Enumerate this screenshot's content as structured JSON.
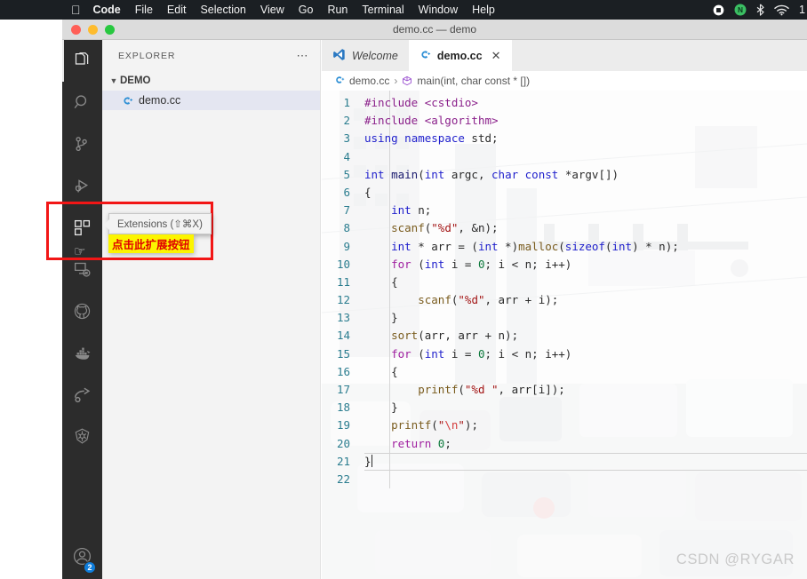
{
  "menubar": {
    "apple_icon": "apple-icon",
    "items": [
      {
        "label": "Code",
        "bold": true
      },
      {
        "label": "File",
        "bold": false
      },
      {
        "label": "Edit",
        "bold": false
      },
      {
        "label": "Selection",
        "bold": false
      },
      {
        "label": "View",
        "bold": false
      },
      {
        "label": "Go",
        "bold": false
      },
      {
        "label": "Run",
        "bold": false
      },
      {
        "label": "Terminal",
        "bold": false
      },
      {
        "label": "Window",
        "bold": false
      },
      {
        "label": "Help",
        "bold": false
      }
    ],
    "status_icons": [
      "record-stop-icon",
      "nordvpn-icon",
      "bluetooth-icon",
      "wifi-icon"
    ],
    "clock": "1"
  },
  "window": {
    "title": "demo.cc — demo",
    "traffic_lights": [
      "close-red",
      "minimize-yellow",
      "zoom-green"
    ]
  },
  "activitybar": {
    "items": [
      {
        "name": "explorer",
        "icon": "files-icon",
        "active": true
      },
      {
        "name": "search",
        "icon": "search-icon",
        "active": false
      },
      {
        "name": "source-control",
        "icon": "source-control-icon",
        "active": false
      },
      {
        "name": "run-and-debug",
        "icon": "run-debug-icon",
        "active": false
      },
      {
        "name": "extensions",
        "icon": "extensions-icon",
        "active": false
      },
      {
        "name": "remote-explorer",
        "icon": "remote-explorer-icon",
        "active": false
      },
      {
        "name": "github",
        "icon": "github-icon",
        "active": false
      },
      {
        "name": "docker",
        "icon": "docker-icon",
        "active": false
      },
      {
        "name": "share",
        "icon": "share-arrow-icon",
        "active": false
      },
      {
        "name": "kubernetes",
        "icon": "kubernetes-icon",
        "active": false
      }
    ],
    "account": {
      "icon": "account-icon",
      "badge": "2"
    }
  },
  "sidebar": {
    "header": "EXPLORER",
    "more_actions": "⋯",
    "folder": {
      "label": "DEMO",
      "expanded": true
    },
    "files": [
      {
        "label": "demo.cc",
        "icon": "cpp-file-icon",
        "selected": true
      }
    ]
  },
  "editor": {
    "tabs": [
      {
        "label": "Welcome",
        "icon": "vscode-logo-icon",
        "active": false,
        "closable": false
      },
      {
        "label": "demo.cc",
        "icon": "cpp-file-icon",
        "active": true,
        "closable": true,
        "close_label": "✕"
      }
    ],
    "breadcrumb": {
      "file": "demo.cc",
      "separator": "›",
      "symbol": "main(int, char const * [])",
      "symbol_icon": "method-icon"
    },
    "cursor_line": 21,
    "lines": [
      {
        "n": 1,
        "tokens": [
          {
            "t": "#include ",
            "c": "pre"
          },
          {
            "t": "<cstdio>",
            "c": "pre"
          }
        ]
      },
      {
        "n": 2,
        "tokens": [
          {
            "t": "#include ",
            "c": "pre"
          },
          {
            "t": "<algorithm>",
            "c": "pre"
          }
        ]
      },
      {
        "n": 3,
        "tokens": [
          {
            "t": "using",
            "c": "kw"
          },
          {
            "t": " ",
            "c": "plain"
          },
          {
            "t": "namespace",
            "c": "kw"
          },
          {
            "t": " std;",
            "c": "plain"
          }
        ]
      },
      {
        "n": 4,
        "tokens": []
      },
      {
        "n": 5,
        "tokens": [
          {
            "t": "int",
            "c": "kw"
          },
          {
            "t": " ",
            "c": "plain"
          },
          {
            "t": "main",
            "c": "var"
          },
          {
            "t": "(",
            "c": "plain"
          },
          {
            "t": "int",
            "c": "kw"
          },
          {
            "t": " argc, ",
            "c": "plain"
          },
          {
            "t": "char",
            "c": "kw"
          },
          {
            "t": " ",
            "c": "plain"
          },
          {
            "t": "const",
            "c": "kw"
          },
          {
            "t": " *argv[])",
            "c": "plain"
          }
        ]
      },
      {
        "n": 6,
        "tokens": [
          {
            "t": "{",
            "c": "plain"
          }
        ]
      },
      {
        "n": 7,
        "tokens": [
          {
            "t": "    ",
            "c": "plain"
          },
          {
            "t": "int",
            "c": "kw"
          },
          {
            "t": " n;",
            "c": "plain"
          }
        ]
      },
      {
        "n": 8,
        "tokens": [
          {
            "t": "    ",
            "c": "plain"
          },
          {
            "t": "scanf",
            "c": "fn"
          },
          {
            "t": "(",
            "c": "plain"
          },
          {
            "t": "\"%d\"",
            "c": "str"
          },
          {
            "t": ", &n);",
            "c": "plain"
          }
        ]
      },
      {
        "n": 9,
        "tokens": [
          {
            "t": "    ",
            "c": "plain"
          },
          {
            "t": "int",
            "c": "kw"
          },
          {
            "t": " * arr = (",
            "c": "plain"
          },
          {
            "t": "int",
            "c": "kw"
          },
          {
            "t": " *)",
            "c": "plain"
          },
          {
            "t": "malloc",
            "c": "fn"
          },
          {
            "t": "(",
            "c": "plain"
          },
          {
            "t": "sizeof",
            "c": "kw"
          },
          {
            "t": "(",
            "c": "plain"
          },
          {
            "t": "int",
            "c": "kw"
          },
          {
            "t": ") * n);",
            "c": "plain"
          }
        ]
      },
      {
        "n": 10,
        "tokens": [
          {
            "t": "    ",
            "c": "plain"
          },
          {
            "t": "for",
            "c": "kw2"
          },
          {
            "t": " (",
            "c": "plain"
          },
          {
            "t": "int",
            "c": "kw"
          },
          {
            "t": " i = ",
            "c": "plain"
          },
          {
            "t": "0",
            "c": "num"
          },
          {
            "t": "; i < n; i++)",
            "c": "plain"
          }
        ]
      },
      {
        "n": 11,
        "tokens": [
          {
            "t": "    {",
            "c": "plain"
          }
        ]
      },
      {
        "n": 12,
        "tokens": [
          {
            "t": "        ",
            "c": "plain"
          },
          {
            "t": "scanf",
            "c": "fn"
          },
          {
            "t": "(",
            "c": "plain"
          },
          {
            "t": "\"%d\"",
            "c": "str"
          },
          {
            "t": ", arr + i);",
            "c": "plain"
          }
        ]
      },
      {
        "n": 13,
        "tokens": [
          {
            "t": "    }",
            "c": "plain"
          }
        ]
      },
      {
        "n": 14,
        "tokens": [
          {
            "t": "    ",
            "c": "plain"
          },
          {
            "t": "sort",
            "c": "fn"
          },
          {
            "t": "(arr, arr + n);",
            "c": "plain"
          }
        ]
      },
      {
        "n": 15,
        "tokens": [
          {
            "t": "    ",
            "c": "plain"
          },
          {
            "t": "for",
            "c": "kw2"
          },
          {
            "t": " (",
            "c": "plain"
          },
          {
            "t": "int",
            "c": "kw"
          },
          {
            "t": " i = ",
            "c": "plain"
          },
          {
            "t": "0",
            "c": "num"
          },
          {
            "t": "; i < n; i++)",
            "c": "plain"
          }
        ]
      },
      {
        "n": 16,
        "tokens": [
          {
            "t": "    {",
            "c": "plain"
          }
        ]
      },
      {
        "n": 17,
        "tokens": [
          {
            "t": "        ",
            "c": "plain"
          },
          {
            "t": "printf",
            "c": "fn"
          },
          {
            "t": "(",
            "c": "plain"
          },
          {
            "t": "\"%d \"",
            "c": "str"
          },
          {
            "t": ", arr[i]);",
            "c": "plain"
          }
        ]
      },
      {
        "n": 18,
        "tokens": [
          {
            "t": "    }",
            "c": "plain"
          }
        ]
      },
      {
        "n": 19,
        "tokens": [
          {
            "t": "    ",
            "c": "plain"
          },
          {
            "t": "printf",
            "c": "fn"
          },
          {
            "t": "(",
            "c": "plain"
          },
          {
            "t": "\"",
            "c": "str"
          },
          {
            "t": "\\n",
            "c": "esc"
          },
          {
            "t": "\"",
            "c": "str"
          },
          {
            "t": ");",
            "c": "plain"
          }
        ]
      },
      {
        "n": 20,
        "tokens": [
          {
            "t": "    ",
            "c": "plain"
          },
          {
            "t": "return",
            "c": "kw2"
          },
          {
            "t": " ",
            "c": "plain"
          },
          {
            "t": "0",
            "c": "num"
          },
          {
            "t": ";",
            "c": "plain"
          }
        ]
      },
      {
        "n": 21,
        "tokens": [
          {
            "t": "}",
            "c": "plain"
          }
        ]
      },
      {
        "n": 22,
        "tokens": []
      }
    ]
  },
  "annotation": {
    "tooltip": "Extensions (⇧⌘X)",
    "note": "点击此扩展按钮",
    "note_bg": "#fcf500",
    "note_color": "#e00000",
    "box_color": "#f21616",
    "cursor": "hand-cursor"
  },
  "watermark": "CSDN @RYGAR"
}
